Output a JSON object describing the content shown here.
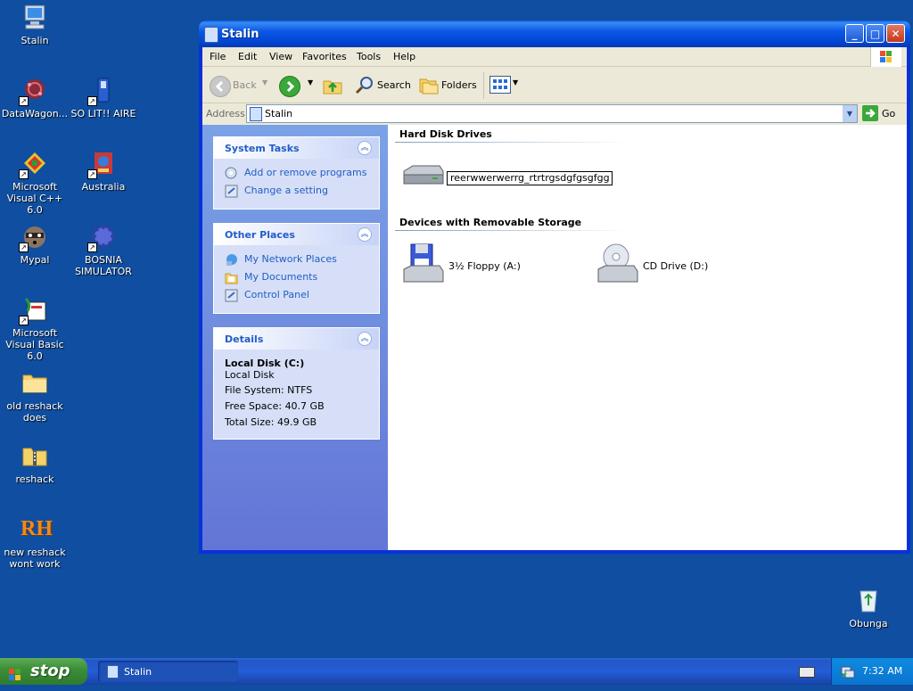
{
  "desktop": {
    "icons": [
      {
        "label": "Stalin"
      },
      {
        "label": "DataWagon..."
      },
      {
        "label": "SO LIT!! AIRE"
      },
      {
        "label": "Microsoft Visual C++ 6.0"
      },
      {
        "label": "Australia"
      },
      {
        "label": "Mypal"
      },
      {
        "label": "BOSNIA SIMULATOR"
      },
      {
        "label": "Microsoft Visual Basic 6.0"
      },
      {
        "label": "old reshack does"
      },
      {
        "label": "reshack"
      },
      {
        "label": "new reshack wont work"
      },
      {
        "label": "Obunga"
      }
    ],
    "rh_glyph": "RH"
  },
  "window": {
    "title": "Stalin",
    "menu": [
      "File",
      "Edit",
      "View",
      "Favorites",
      "Tools",
      "Help"
    ],
    "toolbar": {
      "back": "Back",
      "search": "Search",
      "folders": "Folders"
    },
    "address": {
      "label": "Address",
      "value": "Stalin",
      "go": "Go"
    },
    "task_pane": {
      "system_tasks": {
        "title": "System Tasks",
        "items": [
          "Add or remove programs",
          "Change a setting"
        ]
      },
      "other_places": {
        "title": "Other Places",
        "items": [
          "My Network Places",
          "My Documents",
          "Control Panel"
        ]
      },
      "details": {
        "title": "Details",
        "name": "Local Disk (C:)",
        "type": "Local Disk",
        "file_system": "File System: NTFS",
        "free_space": "Free Space: 40.7 GB",
        "total_size": "Total Size: 49.9 GB"
      }
    },
    "groups": {
      "hard_disk": {
        "title": "Hard Disk Drives",
        "rename_value": "reerwwerwerrg_rtrtrgsdgfgsgfgg"
      },
      "removable": {
        "title": "Devices with Removable Storage",
        "floppy": "3½ Floppy (A:)",
        "cd": "CD Drive (D:)"
      }
    }
  },
  "taskbar": {
    "start": "stop",
    "task_button": "Stalin",
    "clock": "7:32 AM"
  },
  "colors": {
    "desktop": "#0f4ea0",
    "title_blue": "#0a58e6",
    "task_link": "#215dc6"
  }
}
